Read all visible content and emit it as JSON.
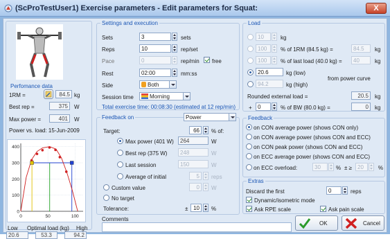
{
  "window": {
    "title": "(ScProTestUser1) Exercise parameters - Edit parameters for Squat:",
    "close_label": "X"
  },
  "left": {
    "performance_header": "Perfomance data",
    "one_rm": {
      "label": "1RM =",
      "value": "84.5",
      "unit": "kg"
    },
    "best_rep": {
      "label": "Best rep =",
      "value": "375",
      "unit": "W"
    },
    "max_power": {
      "label": "Max power =",
      "value": "401",
      "unit": "W"
    },
    "power_vs_load": "Power vs. load: 15-Jun-2009",
    "bottom_labels": {
      "low": "Low",
      "optimal": "Optimal load (kg)",
      "high": "High"
    },
    "bottom_values": {
      "low": "20.6",
      "optimal": "53.3",
      "high": "94.2"
    }
  },
  "chart_data": {
    "type": "scatter",
    "title": "",
    "xlabel": "",
    "ylabel": "",
    "x_ticks": [
      "0",
      "50",
      "100"
    ],
    "y_ticks": [
      "0",
      "100",
      "200",
      "300",
      "400"
    ],
    "xlim": [
      0,
      115
    ],
    "ylim": [
      0,
      420
    ],
    "series": [
      {
        "type": "scatter",
        "color": "#d02020",
        "x": [
          20,
          30,
          40,
          53,
          64,
          72,
          84
        ],
        "y": [
          315,
          355,
          378,
          395,
          380,
          335,
          245
        ]
      },
      {
        "type": "line",
        "color": "#d02020",
        "x": [
          0,
          10,
          20,
          30,
          40,
          53,
          65,
          75,
          85,
          95,
          105
        ],
        "y": [
          0,
          210,
          320,
          370,
          392,
          400,
          385,
          330,
          240,
          130,
          0
        ]
      }
    ],
    "markers": [
      {
        "x": 20.6,
        "y": 300,
        "color": "#e0c000",
        "shape": "square"
      },
      {
        "x": 94.2,
        "y": 300,
        "color": "#2040d0",
        "shape": "square"
      }
    ],
    "hline": {
      "y": 300,
      "x0": 20.6,
      "x1": 94.2,
      "color": "#2040d0"
    },
    "vlines": [
      {
        "x": 20.6,
        "color": "#e0c000"
      },
      {
        "x": 53.3,
        "color": "#20a020"
      },
      {
        "x": 94.2,
        "color": "#2040d0"
      }
    ]
  },
  "settings": {
    "header": "Settings and execution",
    "sets": {
      "label": "Sets",
      "value": "3",
      "unit": "sets"
    },
    "reps": {
      "label": "Reps",
      "value": "10",
      "unit": "rep/set"
    },
    "pace": {
      "label": "Pace",
      "value": "0",
      "unit": "rep/min",
      "free_label": "free"
    },
    "rest": {
      "label": "Rest",
      "value": "02:00",
      "unit": "mm:ss"
    },
    "side": {
      "label": "Side",
      "value": "Both"
    },
    "session_time": {
      "label": "Session time",
      "value": "Morning"
    },
    "total_exercise": "Total exercise time: 00:08:30 (estimated at 12 rep/min)"
  },
  "feedback_on": {
    "header": "Feedback on",
    "combo_value": "Power",
    "target_label": "Target:",
    "target_value": "66",
    "target_unit": "% of:",
    "options": [
      {
        "label": "Max power (401 W)",
        "value": "264",
        "unit": "W",
        "selected": true
      },
      {
        "label": "Best rep (375 W)",
        "value": "248",
        "unit": "W",
        "selected": false
      },
      {
        "label": "Last session",
        "value": "150",
        "unit": "W",
        "selected": false
      },
      {
        "label": "Average of initial",
        "value": "5",
        "unit": "reps",
        "selected": false
      }
    ],
    "custom_label": "Custom value",
    "custom_value": "0",
    "custom_unit": "W",
    "no_target_label": "No target",
    "tolerance_label": "Tolerance:",
    "tolerance_prefix": "±",
    "tolerance_value": "10",
    "tolerance_unit": "%"
  },
  "comments_label": "Comments",
  "load": {
    "header": "Load",
    "rows": [
      {
        "value": "10",
        "unit": "kg",
        "desc": "",
        "value2": "",
        "unit2": "",
        "selected": false,
        "enabled": false
      },
      {
        "value": "100",
        "unit": "% of 1RM (84.5 kg) =",
        "desc": "",
        "value2": "84.5",
        "unit2": "kg",
        "selected": false,
        "enabled": false
      },
      {
        "value": "100",
        "unit": "% of last load (40.0 kg) =",
        "desc": "",
        "value2": "40",
        "unit2": "kg",
        "selected": false,
        "enabled": false
      },
      {
        "value": "20.6",
        "unit": "kg (low)",
        "desc": "from power curve",
        "value2": "",
        "unit2": "",
        "selected": true,
        "enabled": true
      },
      {
        "value": "94.2",
        "unit": "kg (high)",
        "desc": "",
        "value2": "",
        "unit2": "",
        "selected": false,
        "enabled": false
      }
    ],
    "rounded_label": "Rounded external load =",
    "rounded_value": "20.5",
    "rounded_unit": "kg",
    "plus_label": "+",
    "bw_value": "0",
    "bw_unit": "% of BW (80.0 kg) =",
    "bw_result": "0",
    "bw_result_unit": "kg"
  },
  "feedback": {
    "header": "Feedback",
    "options": [
      {
        "label": "on CON average power (shows CON only)",
        "selected": true
      },
      {
        "label": "on CON average power (shows CON and ECC)",
        "selected": false
      },
      {
        "label": "on CON peak power (shows CON and ECC)",
        "selected": false
      },
      {
        "label": "on ECC average power (shows CON and ECC)",
        "selected": false
      },
      {
        "label": "on ECC overload:",
        "selected": false
      }
    ],
    "overload_value": "30",
    "overload_unit": "%",
    "overload_pm": "± ≥",
    "overload_value2": "20",
    "overload_unit2": "%"
  },
  "extras": {
    "header": "Extras",
    "discard_label": "Discard the first",
    "discard_value": "0",
    "discard_unit": "reps",
    "dynamic_label": "Dynamic/isometric mode",
    "rpe_label": "Ask RPE scale",
    "pain_label": "Ask pain scale"
  },
  "buttons": {
    "ok": "OK",
    "cancel": "Cancel"
  },
  "colors": {
    "accent": "#1c57b5",
    "ok_check": "#2a9a2a",
    "cancel_x": "#d02020"
  }
}
